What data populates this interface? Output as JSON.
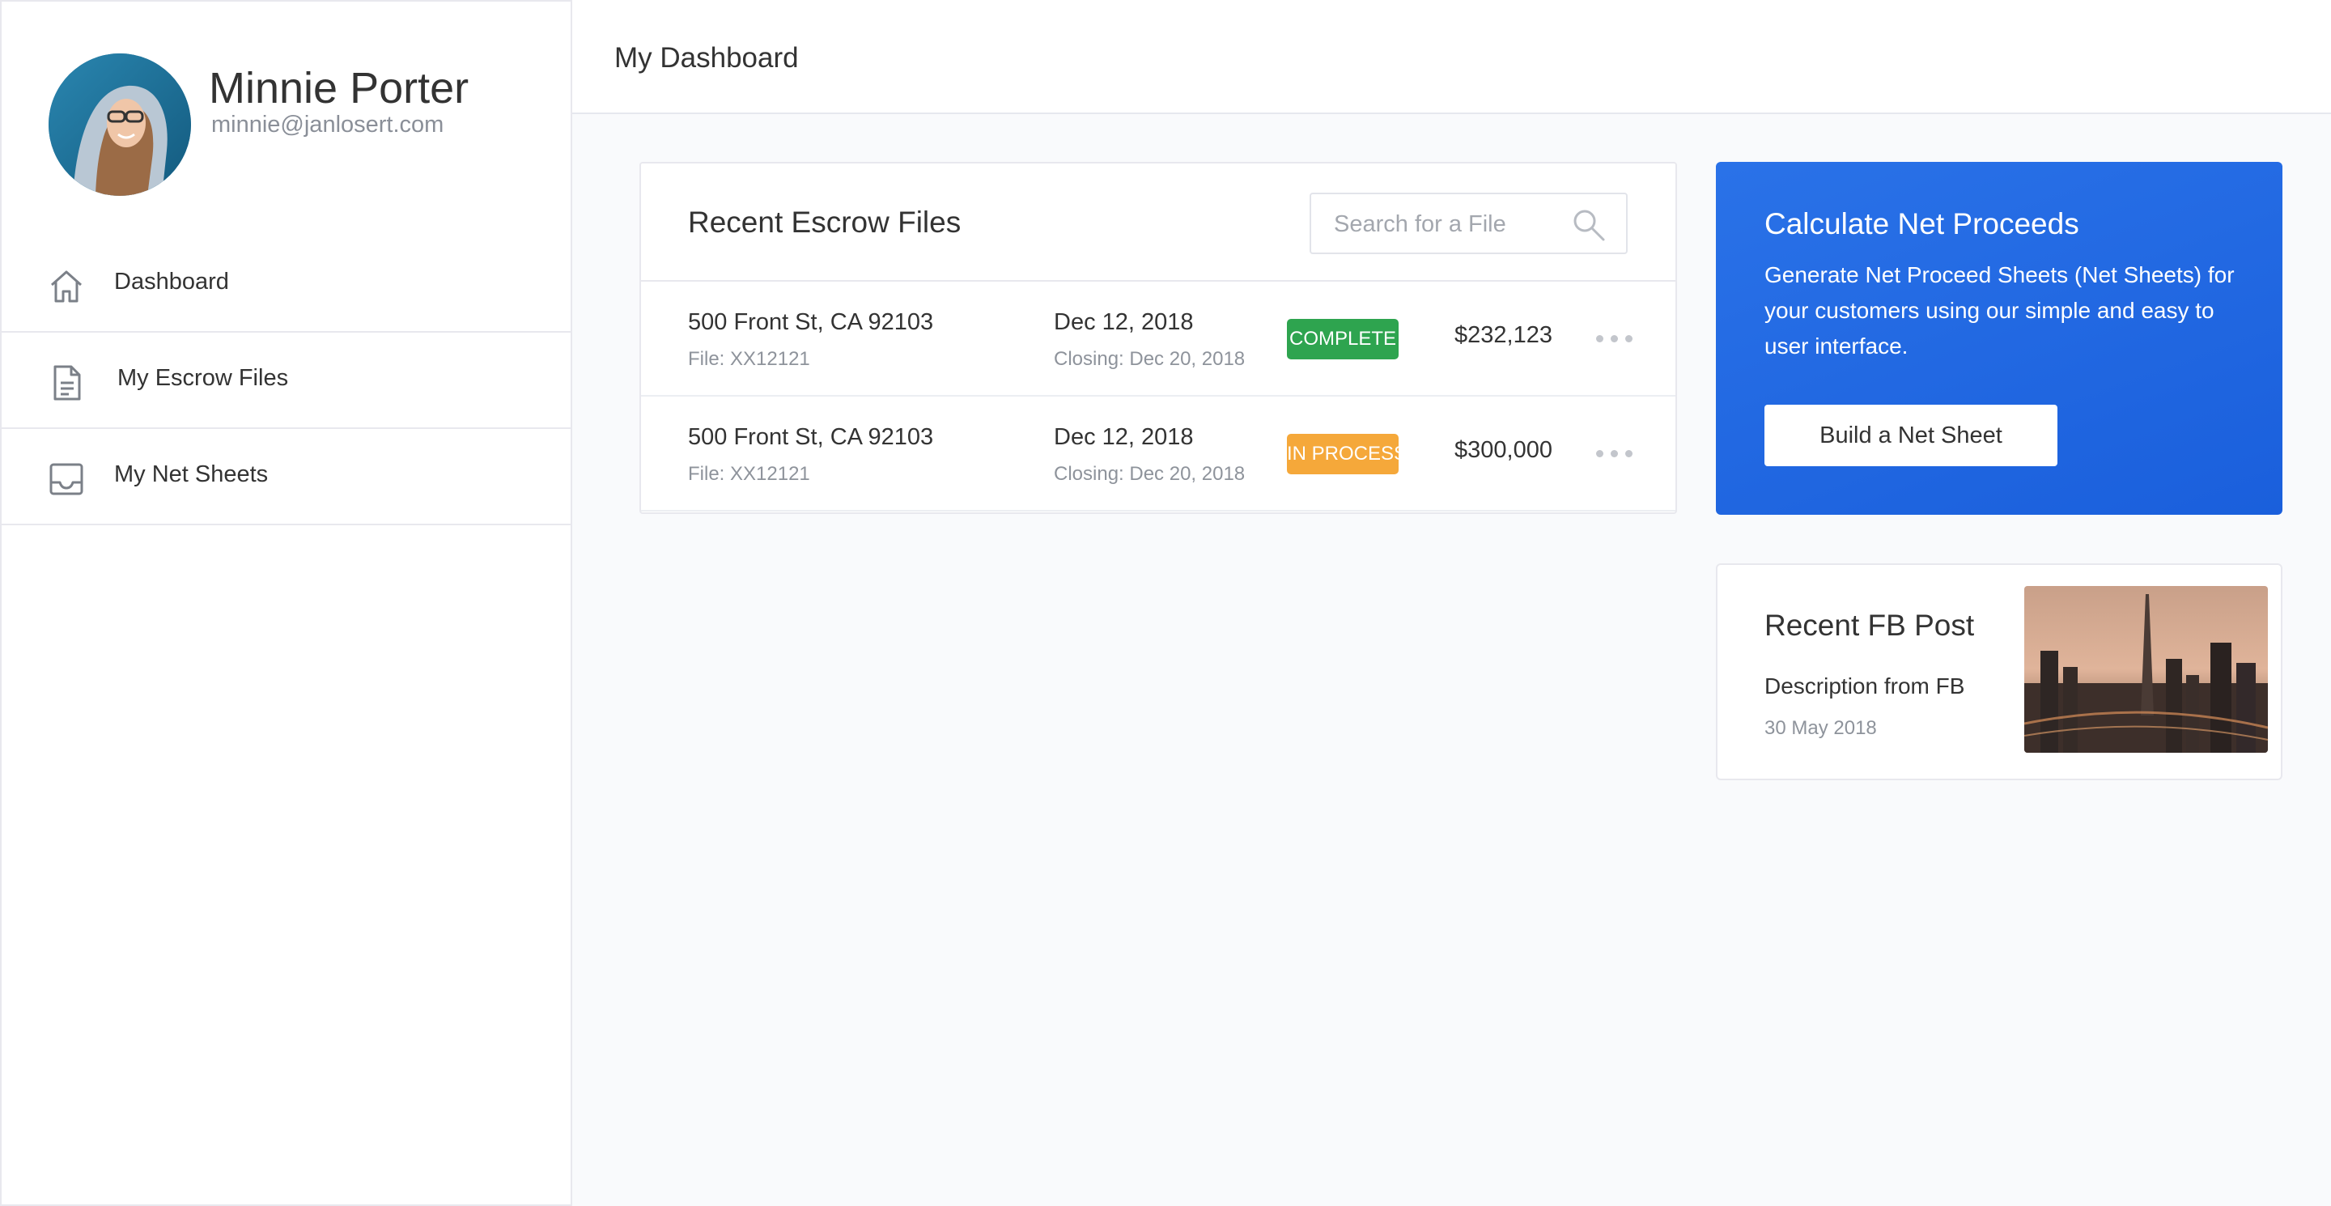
{
  "user": {
    "name": "Minnie Porter",
    "email": "minnie@janlosert.com"
  },
  "nav": {
    "items": [
      {
        "label": "Dashboard",
        "icon": "home-icon"
      },
      {
        "label": "My Escrow Files",
        "icon": "document-icon"
      },
      {
        "label": "My Net Sheets",
        "icon": "inbox-icon"
      }
    ]
  },
  "header": {
    "title": "My Dashboard"
  },
  "escrow": {
    "title": "Recent Escrow Files",
    "search_placeholder": "Search for a File",
    "rows": [
      {
        "address": "500 Front St, CA 92103",
        "file": "File: XX12121",
        "date": "Dec 12, 2018",
        "closing": "Closing: Dec 20, 2018",
        "status": "COMPLETE",
        "status_color": "#2ea44f",
        "amount": "$232,123"
      },
      {
        "address": "500 Front St, CA 92103",
        "file": "File: XX12121",
        "date": "Dec 12, 2018",
        "closing": "Closing: Dec 20, 2018",
        "status": "IN PROCESS",
        "status_color": "#f5a83a",
        "amount": "$300,000"
      }
    ]
  },
  "proceeds": {
    "title": "Calculate Net Proceeds",
    "text": "Generate Net Proceed Sheets (Net Sheets) for your customers using our simple and easy to user interface.",
    "button": "Build a Net Sheet",
    "accent": "#1f66e0"
  },
  "fb": {
    "title": "Recent FB Post",
    "description": "Description from FB",
    "date": "30 May 2018"
  }
}
